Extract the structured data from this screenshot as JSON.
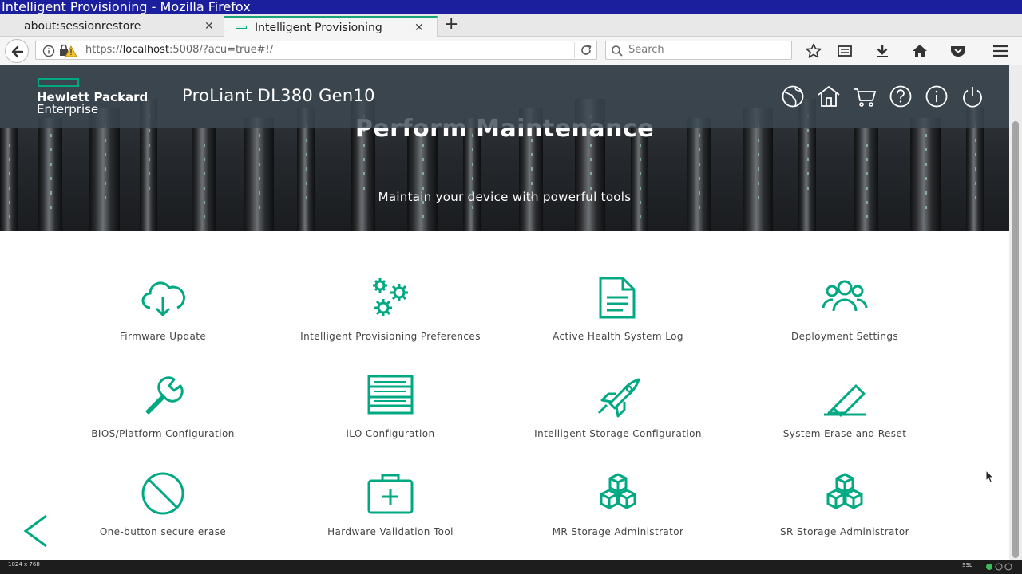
{
  "window": {
    "title": "Intelligent Provisioning - Mozilla Firefox"
  },
  "tabs": [
    {
      "label": "about:sessionrestore",
      "close": "✕"
    },
    {
      "label": "Intelligent Provisioning",
      "close": "✕"
    }
  ],
  "newtab": "+",
  "urlbar": {
    "prefix": "https://",
    "host": "localhost",
    "rest": ":5008/?acu=true#!/"
  },
  "search": {
    "placeholder": "Search"
  },
  "header": {
    "brand_line1": "Hewlett Packard",
    "brand_line2": "Enterprise",
    "product": "ProLiant DL380 Gen10",
    "icons": [
      "language-icon",
      "home-icon",
      "cart-icon",
      "help-icon",
      "info-icon",
      "power-icon"
    ]
  },
  "hero": {
    "title": "Perform Maintenance",
    "subtitle": "Maintain your device with powerful tools"
  },
  "tiles": [
    {
      "label": "Firmware Update",
      "icon": "cloud-download-icon"
    },
    {
      "label": "Intelligent Provisioning Preferences",
      "icon": "gears-icon"
    },
    {
      "label": "Active Health System Log",
      "icon": "document-icon"
    },
    {
      "label": "Deployment Settings",
      "icon": "group-icon"
    },
    {
      "label": "BIOS/Platform Configuration",
      "icon": "wrench-icon"
    },
    {
      "label": "iLO Configuration",
      "icon": "server-icon"
    },
    {
      "label": "Intelligent Storage Configuration",
      "icon": "rocket-icon"
    },
    {
      "label": "System Erase and Reset",
      "icon": "eraser-icon"
    },
    {
      "label": "One-button secure erase",
      "icon": "prohibit-icon"
    },
    {
      "label": "Hardware Validation Tool",
      "icon": "first-aid-kit-icon"
    },
    {
      "label": "MR Storage Administrator",
      "icon": "cubes-icon"
    },
    {
      "label": "SR Storage Administrator",
      "icon": "cubes-icon"
    }
  ],
  "status": {
    "resolution": "1024 x 768",
    "ssl": "SSL"
  },
  "colors": {
    "accent": "#01a982",
    "titlebar": "#1b1f9e"
  }
}
